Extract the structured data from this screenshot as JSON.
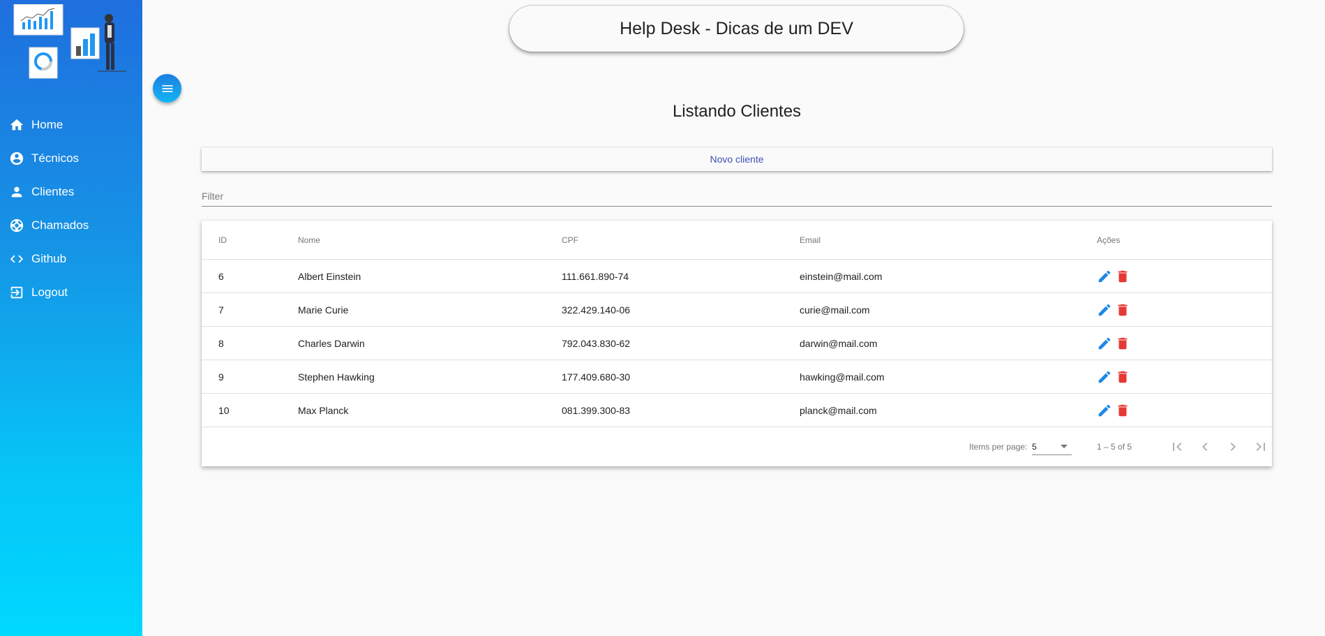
{
  "header": {
    "title": "Help Desk - Dicas de um DEV"
  },
  "sidebar": {
    "items": [
      {
        "label": "Home",
        "icon": "home-icon"
      },
      {
        "label": "Técnicos",
        "icon": "account-circle-icon"
      },
      {
        "label": "Clientes",
        "icon": "person-icon"
      },
      {
        "label": "Chamados",
        "icon": "lifebuoy-icon"
      },
      {
        "label": "Github",
        "icon": "code-icon"
      },
      {
        "label": "Logout",
        "icon": "logout-icon"
      }
    ]
  },
  "main": {
    "title": "Listando Clientes",
    "new_button": "Novo cliente",
    "filter_placeholder": "Filter",
    "table": {
      "headers": [
        "ID",
        "Nome",
        "CPF",
        "Email",
        "Ações"
      ],
      "rows": [
        {
          "id": "6",
          "nome": "Albert Einstein",
          "cpf": "111.661.890-74",
          "email": "einstein@mail.com"
        },
        {
          "id": "7",
          "nome": "Marie Curie",
          "cpf": "322.429.140-06",
          "email": "curie@mail.com"
        },
        {
          "id": "8",
          "nome": "Charles Darwin",
          "cpf": "792.043.830-62",
          "email": "darwin@mail.com"
        },
        {
          "id": "9",
          "nome": "Stephen Hawking",
          "cpf": "177.409.680-30",
          "email": "hawking@mail.com"
        },
        {
          "id": "10",
          "nome": "Max Planck",
          "cpf": "081.399.300-83",
          "email": "planck@mail.com"
        }
      ]
    },
    "paginator": {
      "items_per_page_label": "Items per page:",
      "items_per_page_value": "5",
      "range_label": "1 – 5 of 5"
    }
  },
  "colors": {
    "edit": "#1e88e5",
    "delete": "#e53935",
    "accent": "#3f51b5"
  }
}
